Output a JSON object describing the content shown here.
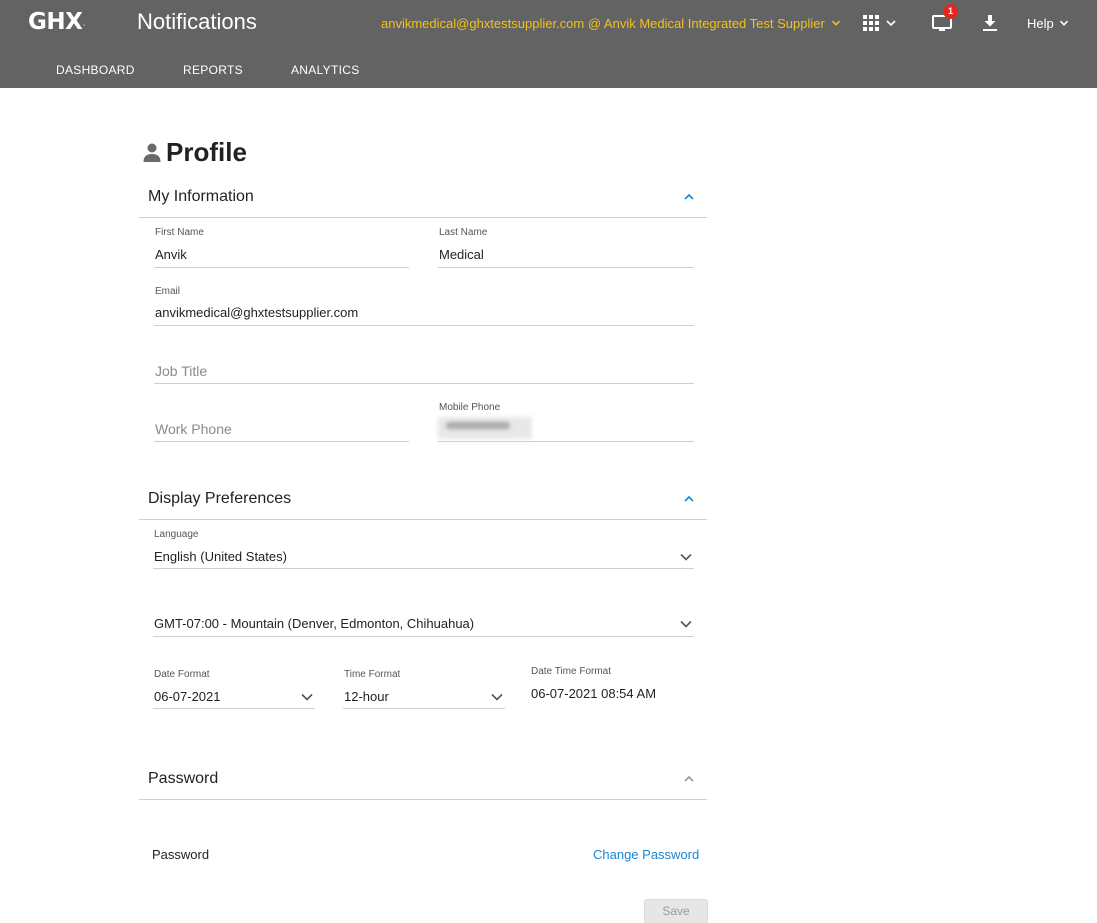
{
  "header": {
    "logo_text": "GHX",
    "logo_mark": ".",
    "app_title": "Notifications",
    "account": "anvikmedical@ghxtestsupplier.com @ Anvik Medical Integrated Test Supplier",
    "notification_count": "1",
    "help_label": "Help",
    "nav": [
      {
        "label": "DASHBOARD"
      },
      {
        "label": "REPORTS"
      },
      {
        "label": "ANALYTICS"
      }
    ]
  },
  "page": {
    "title": "Profile"
  },
  "my_information": {
    "title": "My Information",
    "first_name": {
      "label": "First Name",
      "value": "Anvik"
    },
    "last_name": {
      "label": "Last Name",
      "value": "Medical"
    },
    "email": {
      "label": "Email",
      "value": "anvikmedical@ghxtestsupplier.com"
    },
    "job_title": {
      "placeholder": "Job Title"
    },
    "work_phone": {
      "placeholder": "Work Phone"
    },
    "mobile_phone": {
      "label": "Mobile Phone"
    }
  },
  "display_preferences": {
    "title": "Display Preferences",
    "language": {
      "label": "Language",
      "value": "English (United States)"
    },
    "timezone": {
      "value": "GMT-07:00 - Mountain (Denver, Edmonton, Chihuahua)"
    },
    "date_format": {
      "label": "Date Format",
      "value": "06-07-2021"
    },
    "time_format": {
      "label": "Time Format",
      "value": "12-hour"
    },
    "date_time_format": {
      "label": "Date Time Format",
      "value": "06-07-2021 08:54 AM"
    }
  },
  "password": {
    "title": "Password",
    "label": "Password",
    "change_link": "Change Password"
  },
  "actions": {
    "save_label": "Save"
  },
  "colors": {
    "header_bg": "#636363",
    "account_text": "#f2c11a",
    "link_blue": "#1a86d0",
    "badge_red": "#e0281e"
  },
  "icons": {
    "profile": "person-icon",
    "apps": "grid-icon",
    "notifications": "monitor-icon",
    "download": "download-icon",
    "section_toggle": "chevron-up-icon",
    "dropdown": "chevron-down-icon"
  }
}
